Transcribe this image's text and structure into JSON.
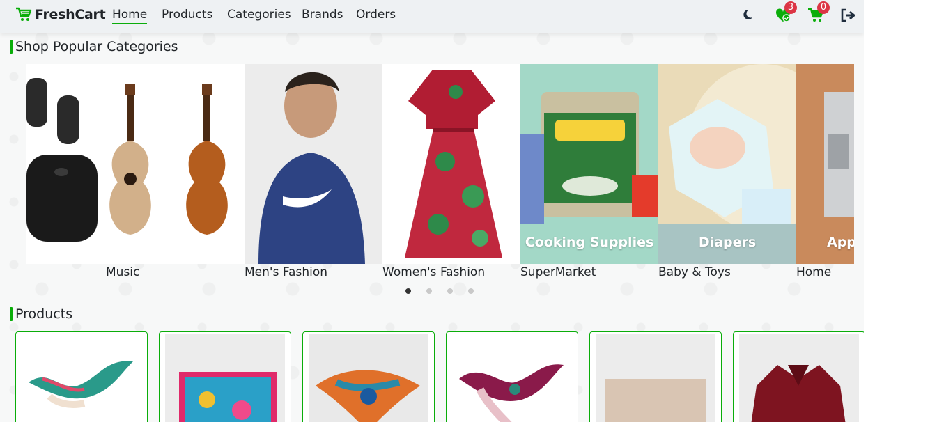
{
  "brand": {
    "name": "FreshCart",
    "accent": "#0aad0a"
  },
  "nav": {
    "links": [
      {
        "label": "Home",
        "active": true
      },
      {
        "label": "Products",
        "active": false
      },
      {
        "label": "Categories",
        "active": false
      },
      {
        "label": "Brands",
        "active": false
      },
      {
        "label": "Orders",
        "active": false
      }
    ],
    "icons": {
      "theme": "moon-icon",
      "wishlist": "heart-check-icon",
      "cart": "cart-icon",
      "logout": "sign-out-icon"
    },
    "wishlist_count": "3",
    "cart_count": "0"
  },
  "categories_section": {
    "title": "Shop Popular Categories",
    "items": [
      {
        "label": "Music",
        "overlay": ""
      },
      {
        "label": "Men's Fashion",
        "overlay": ""
      },
      {
        "label": "Women's Fashion",
        "overlay": ""
      },
      {
        "label": "SuperMarket",
        "overlay": "Cooking Supplies"
      },
      {
        "label": "Baby & Toys",
        "overlay": "Diapers"
      },
      {
        "label": "Home",
        "overlay": "App"
      }
    ],
    "pagination": {
      "pages": 4,
      "active": 1
    }
  },
  "products_section": {
    "title": "Products",
    "items": [
      {
        "image": "scarf-image"
      },
      {
        "image": "square-scarf-image"
      },
      {
        "image": "scarf-image"
      },
      {
        "image": "scarf-image"
      },
      {
        "image": "beige-fabric-image"
      },
      {
        "image": "red-blouse-image"
      }
    ]
  }
}
